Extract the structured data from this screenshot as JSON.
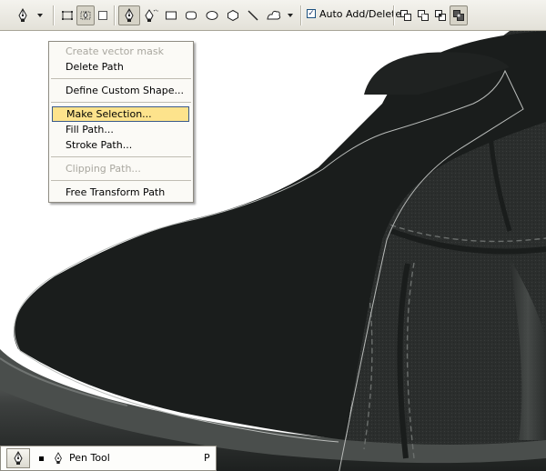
{
  "options_bar": {
    "tools": [
      {
        "name": "pen-tool-icon"
      },
      {
        "name": "shape-layers-icon"
      },
      {
        "name": "paths-icon"
      },
      {
        "name": "fill-pixels-icon"
      },
      {
        "name": "pen-icon"
      },
      {
        "name": "freeform-pen-icon"
      },
      {
        "name": "rectangle-icon"
      },
      {
        "name": "rounded-rectangle-icon"
      },
      {
        "name": "ellipse-icon"
      },
      {
        "name": "polygon-icon"
      },
      {
        "name": "line-icon"
      },
      {
        "name": "custom-shape-icon"
      }
    ],
    "auto_add_delete": {
      "label": "Auto Add/Delete",
      "checked": true
    },
    "path_ops": [
      "add-to-path-area-icon",
      "subtract-from-path-area-icon",
      "intersect-path-areas-icon",
      "exclude-overlapping-path-areas-icon"
    ]
  },
  "context_menu": {
    "items": [
      {
        "label": "Create vector mask",
        "disabled": true
      },
      {
        "label": "Delete Path",
        "disabled": false
      },
      {
        "label": "Define Custom Shape...",
        "disabled": false
      },
      {
        "label": "Make Selection...",
        "disabled": false,
        "highlighted": true
      },
      {
        "label": "Fill Path...",
        "disabled": false
      },
      {
        "label": "Stroke Path...",
        "disabled": false
      },
      {
        "label": "Clipping Path...",
        "disabled": true
      },
      {
        "label": "Free Transform Path",
        "disabled": false
      }
    ]
  },
  "tool_presets": {
    "current_tool": "Pen Tool",
    "shortcut": "P"
  },
  "colors": {
    "toolbar_bg": "#e3e1d8",
    "highlight": "#fde38c",
    "shoe_dark": "#1a1d1c",
    "path_stroke": "#b9bcba"
  }
}
